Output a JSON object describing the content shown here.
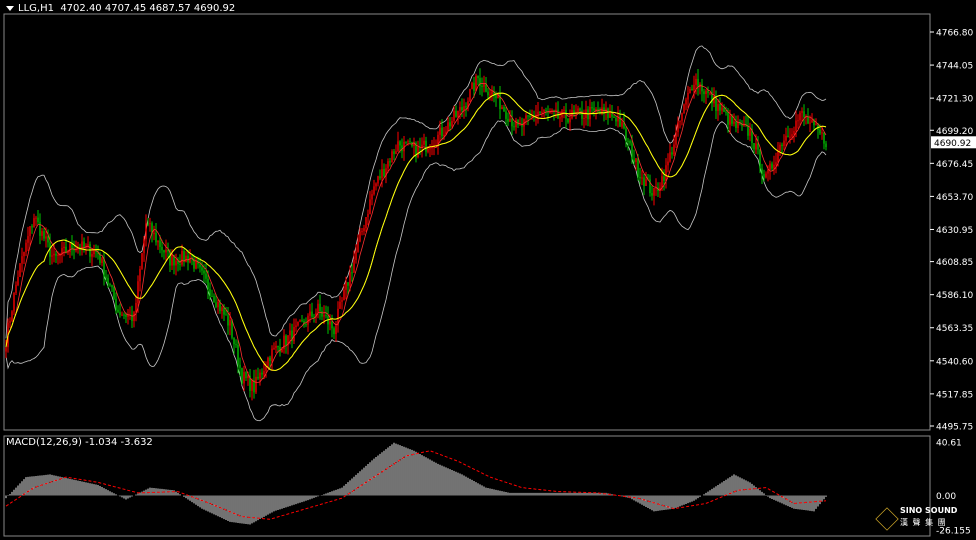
{
  "header": {
    "symbol": "LLG,H1",
    "ohlc": "4702.40 4707.45 4687.57 4690.92"
  },
  "indicator": {
    "label": "MACD(12,26,9)",
    "values": "-1.034 -3.632"
  },
  "logo": {
    "line1": "SINO SOUND",
    "line2": "漢 聲 集 團"
  },
  "colors": {
    "background": "#000000",
    "bull": "#ff0000",
    "bear": "#00c800",
    "ma": "#ffff00",
    "bands": "#c8c8c8",
    "macd_hist": "#ffffff",
    "macd_signal": "#ff0000",
    "axis": "#ffffff"
  },
  "chart_data": [
    {
      "type": "candlestick",
      "title": "LLG,H1",
      "price_ticks": [
        "4766.80",
        "4744.05",
        "4721.30",
        "4699.20",
        "4676.45",
        "4653.70",
        "4630.95",
        "4608.85",
        "4586.10",
        "4563.35",
        "4540.60",
        "4517.85",
        "4495.75"
      ],
      "current_price": "4690.92",
      "ylim": [
        4495.75,
        4766.8
      ],
      "overlays": [
        "Bollinger Bands",
        "Moving Average"
      ],
      "anchors": [
        [
          0,
          4555
        ],
        [
          6,
          4600
        ],
        [
          14,
          4640
        ],
        [
          24,
          4610
        ],
        [
          34,
          4620
        ],
        [
          46,
          4615
        ],
        [
          56,
          4575
        ],
        [
          64,
          4570
        ],
        [
          70,
          4635
        ],
        [
          82,
          4610
        ],
        [
          92,
          4612
        ],
        [
          102,
          4590
        ],
        [
          112,
          4565
        ],
        [
          118,
          4530
        ],
        [
          124,
          4522
        ],
        [
          132,
          4545
        ],
        [
          144,
          4560
        ],
        [
          156,
          4576
        ],
        [
          164,
          4562
        ],
        [
          172,
          4600
        ],
        [
          184,
          4660
        ],
        [
          196,
          4690
        ],
        [
          206,
          4685
        ],
        [
          216,
          4695
        ],
        [
          228,
          4714
        ],
        [
          236,
          4735
        ],
        [
          246,
          4720
        ],
        [
          256,
          4700
        ],
        [
          266,
          4712
        ],
        [
          276,
          4708
        ],
        [
          288,
          4710
        ],
        [
          296,
          4712
        ],
        [
          306,
          4708
        ],
        [
          316,
          4672
        ],
        [
          324,
          4655
        ],
        [
          330,
          4672
        ],
        [
          338,
          4710
        ],
        [
          344,
          4735
        ],
        [
          352,
          4722
        ],
        [
          364,
          4702
        ],
        [
          372,
          4698
        ],
        [
          380,
          4665
        ],
        [
          388,
          4692
        ],
        [
          398,
          4710
        ],
        [
          404,
          4700
        ],
        [
          410,
          4692
        ]
      ],
      "macd": {
        "ylim": [
          -26.155,
          40.61
        ],
        "ticks": [
          "40.61",
          "0.00",
          "-26.155"
        ],
        "hist_anchors": [
          [
            0,
            -2
          ],
          [
            10,
            14
          ],
          [
            22,
            16
          ],
          [
            34,
            12
          ],
          [
            46,
            8
          ],
          [
            60,
            -3
          ],
          [
            72,
            6
          ],
          [
            84,
            4
          ],
          [
            98,
            -10
          ],
          [
            112,
            -20
          ],
          [
            122,
            -22
          ],
          [
            134,
            -12
          ],
          [
            150,
            -4
          ],
          [
            168,
            6
          ],
          [
            184,
            28
          ],
          [
            194,
            40
          ],
          [
            204,
            34
          ],
          [
            216,
            24
          ],
          [
            228,
            16
          ],
          [
            240,
            6
          ],
          [
            252,
            2
          ],
          [
            266,
            2
          ],
          [
            282,
            2
          ],
          [
            300,
            2
          ],
          [
            312,
            -2
          ],
          [
            324,
            -12
          ],
          [
            334,
            -10
          ],
          [
            344,
            -4
          ],
          [
            354,
            6
          ],
          [
            364,
            16
          ],
          [
            372,
            10
          ],
          [
            382,
            -2
          ],
          [
            394,
            -10
          ],
          [
            404,
            -12
          ],
          [
            410,
            -1
          ]
        ],
        "signal_anchors": [
          [
            0,
            -8
          ],
          [
            14,
            6
          ],
          [
            30,
            14
          ],
          [
            46,
            10
          ],
          [
            66,
            2
          ],
          [
            86,
            3
          ],
          [
            102,
            -6
          ],
          [
            118,
            -16
          ],
          [
            132,
            -18
          ],
          [
            150,
            -10
          ],
          [
            168,
            -2
          ],
          [
            186,
            16
          ],
          [
            200,
            30
          ],
          [
            212,
            34
          ],
          [
            226,
            26
          ],
          [
            242,
            14
          ],
          [
            258,
            6
          ],
          [
            276,
            3
          ],
          [
            296,
            2
          ],
          [
            316,
            -2
          ],
          [
            334,
            -10
          ],
          [
            350,
            -6
          ],
          [
            366,
            4
          ],
          [
            380,
            6
          ],
          [
            394,
            -6
          ],
          [
            410,
            -4
          ]
        ]
      }
    }
  ]
}
